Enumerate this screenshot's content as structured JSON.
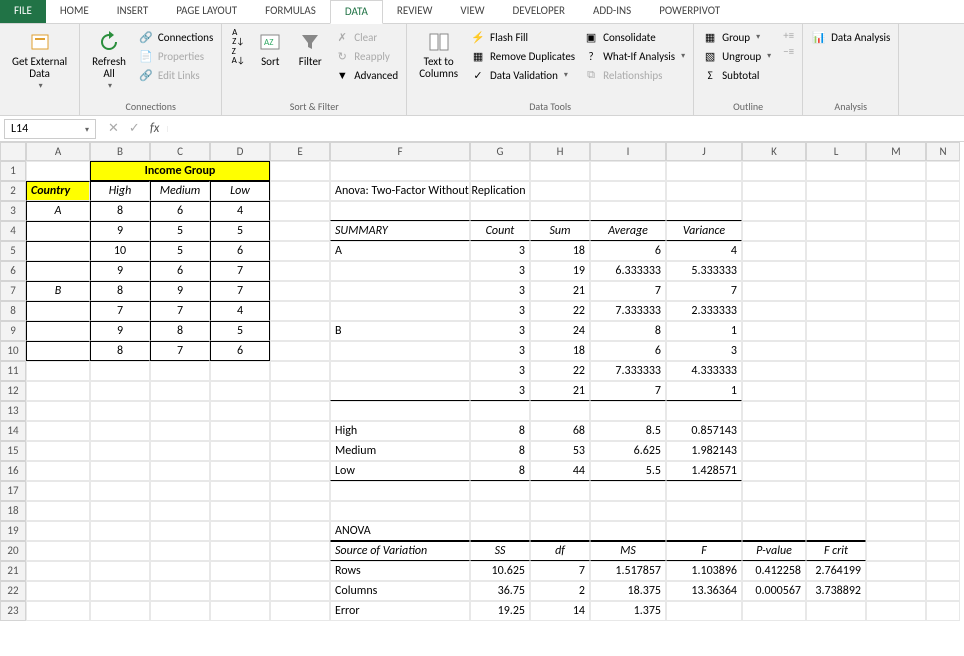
{
  "tabs": [
    "FILE",
    "HOME",
    "INSERT",
    "PAGE LAYOUT",
    "FORMULAS",
    "DATA",
    "REVIEW",
    "VIEW",
    "DEVELOPER",
    "ADD-INS",
    "POWERPIVOT"
  ],
  "activeTab": "DATA",
  "ribbon": {
    "getExternalData": "Get External\nData",
    "refreshAll": "Refresh\nAll",
    "connections": "Connections",
    "properties": "Properties",
    "editLinks": "Edit Links",
    "groupConnections": "Connections",
    "sortAZ": "A→Z",
    "sortZA": "Z→A",
    "sort": "Sort",
    "filter": "Filter",
    "clear": "Clear",
    "reapply": "Reapply",
    "advanced": "Advanced",
    "groupSortFilter": "Sort & Filter",
    "textToColumns": "Text to\nColumns",
    "flashFill": "Flash Fill",
    "removeDuplicates": "Remove Duplicates",
    "dataValidation": "Data Validation",
    "consolidate": "Consolidate",
    "whatIf": "What-If Analysis",
    "relationships": "Relationships",
    "groupDataTools": "Data Tools",
    "group": "Group",
    "ungroup": "Ungroup",
    "subtotal": "Subtotal",
    "groupOutline": "Outline",
    "dataAnalysis": "Data Analysis",
    "groupAnalysis": "Analysis"
  },
  "nameBox": "L14",
  "formula": "",
  "cols": [
    "A",
    "B",
    "C",
    "D",
    "E",
    "F",
    "G",
    "H",
    "I",
    "J",
    "K",
    "L",
    "M",
    "N"
  ],
  "grid": {
    "mergeB1D1": "Income Group",
    "A2": "Country",
    "B2": "High",
    "C2": "Medium",
    "D2": "Low",
    "A3": "A",
    "B3": "8",
    "C3": "6",
    "D3": "4",
    "B4": "9",
    "C4": "5",
    "D4": "5",
    "B5": "10",
    "C5": "5",
    "D5": "6",
    "B6": "9",
    "C6": "6",
    "D6": "7",
    "A7": "B",
    "B7": "8",
    "C7": "9",
    "D7": "7",
    "B8": "7",
    "C8": "7",
    "D8": "4",
    "B9": "9",
    "C9": "8",
    "D9": "5",
    "B10": "8",
    "C10": "7",
    "D10": "6",
    "F2": "Anova: Two-Factor Without Replication",
    "F4": "SUMMARY",
    "G4": "Count",
    "H4": "Sum",
    "I4": "Average",
    "J4": "Variance",
    "F5": "A",
    "G5": "3",
    "H5": "18",
    "I5": "6",
    "J5": "4",
    "G6": "3",
    "H6": "19",
    "I6": "6.333333",
    "J6": "5.333333",
    "G7": "3",
    "H7": "21",
    "I7": "7",
    "J7": "7",
    "G8": "3",
    "H8": "22",
    "I8": "7.333333",
    "J8": "2.333333",
    "F9": "B",
    "G9": "3",
    "H9": "24",
    "I9": "8",
    "J9": "1",
    "G10": "3",
    "H10": "18",
    "I10": "6",
    "J10": "3",
    "G11": "3",
    "H11": "22",
    "I11": "7.333333",
    "J11": "4.333333",
    "G12": "3",
    "H12": "21",
    "I12": "7",
    "J12": "1",
    "F14": "High",
    "G14": "8",
    "H14": "68",
    "I14": "8.5",
    "J14": "0.857143",
    "F15": "Medium",
    "G15": "8",
    "H15": "53",
    "I15": "6.625",
    "J15": "1.982143",
    "F16": "Low",
    "G16": "8",
    "H16": "44",
    "I16": "5.5",
    "J16": "1.428571",
    "F19": "ANOVA",
    "F20": "Source of Variation",
    "G20": "SS",
    "H20": "df",
    "I20": "MS",
    "J20": "F",
    "K20": "P-value",
    "L20": "F crit",
    "F21": "Rows",
    "G21": "10.625",
    "H21": "7",
    "I21": "1.517857",
    "J21": "1.103896",
    "K21": "0.412258",
    "L21": "2.764199",
    "F22": "Columns",
    "G22": "36.75",
    "H22": "2",
    "I22": "18.375",
    "J22": "13.36364",
    "K22": "0.000567",
    "L22": "3.738892",
    "F23": "Error",
    "G23": "19.25",
    "H23": "14",
    "I23": "1.375"
  }
}
